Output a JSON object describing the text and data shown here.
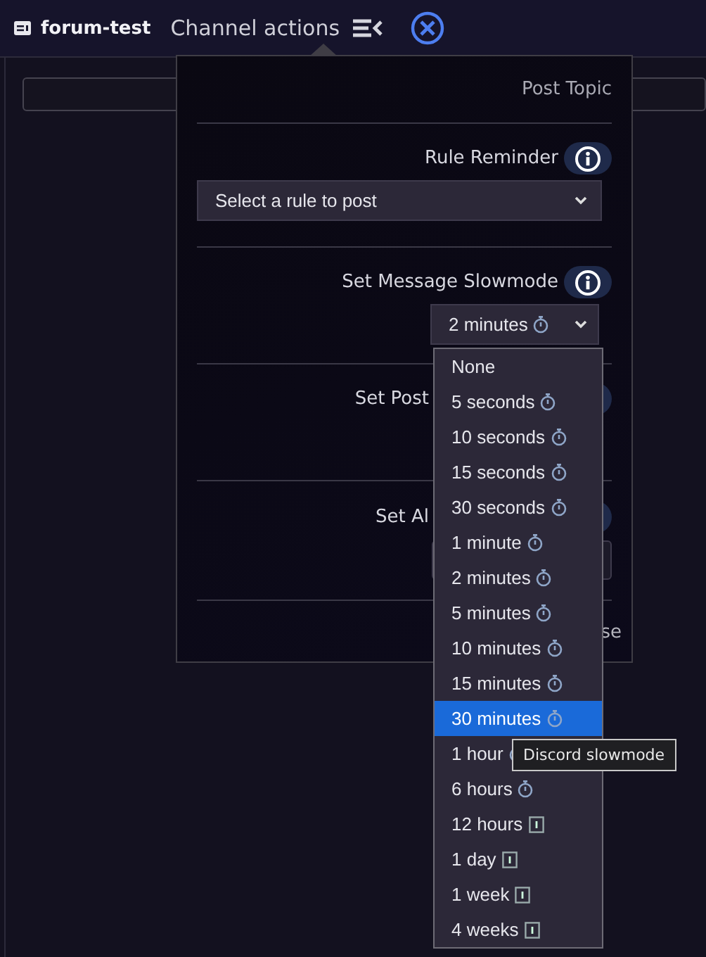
{
  "header": {
    "channel": "forum-test",
    "title": "Channel actions"
  },
  "panel": {
    "sections": [
      {
        "kind": "link",
        "label": "Post Topic"
      },
      {
        "kind": "select",
        "label": "Rule Reminder",
        "value": "Select a rule to post"
      },
      {
        "kind": "compact-select",
        "label": "Set Message Slowmode",
        "value": {
          "text": "2 minutes",
          "kind": "timer"
        }
      },
      {
        "kind": "covered",
        "label": "Set Post"
      },
      {
        "kind": "covered-field",
        "label": "Set Al"
      },
      {
        "kind": "footer",
        "label": "se"
      }
    ]
  },
  "dropdown": {
    "options": [
      {
        "label": "None",
        "kind": "plain",
        "selected": false
      },
      {
        "label": "5 seconds",
        "kind": "timer",
        "selected": false
      },
      {
        "label": "10 seconds",
        "kind": "timer",
        "selected": false
      },
      {
        "label": "15 seconds",
        "kind": "timer",
        "selected": false
      },
      {
        "label": "30 seconds",
        "kind": "timer",
        "selected": false
      },
      {
        "label": "1 minute",
        "kind": "timer",
        "selected": false
      },
      {
        "label": "2 minutes",
        "kind": "timer",
        "selected": false
      },
      {
        "label": "5 minutes",
        "kind": "timer",
        "selected": false
      },
      {
        "label": "10 minutes",
        "kind": "timer",
        "selected": false
      },
      {
        "label": "15 minutes",
        "kind": "timer",
        "selected": false
      },
      {
        "label": "30 minutes",
        "kind": "timer",
        "selected": true
      },
      {
        "label": "1 hour",
        "kind": "timer",
        "selected": false
      },
      {
        "label": "6 hours",
        "kind": "timer",
        "selected": false
      },
      {
        "label": "12 hours",
        "kind": "calendar",
        "selected": false
      },
      {
        "label": "1 day",
        "kind": "calendar",
        "selected": false
      },
      {
        "label": "1 week",
        "kind": "calendar",
        "selected": false
      },
      {
        "label": "4 weeks",
        "kind": "calendar",
        "selected": false
      }
    ]
  },
  "tooltip": "Discord slowmode"
}
